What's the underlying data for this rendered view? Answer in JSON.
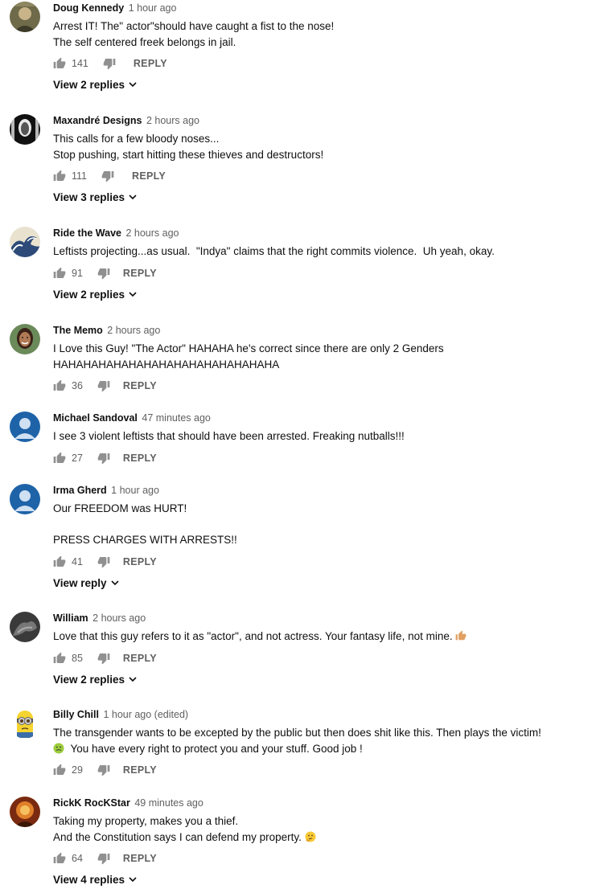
{
  "icons": {
    "like": "thumbs-up-icon",
    "dislike": "thumbs-down-icon",
    "expand": "chevron-down-icon"
  },
  "colors": {
    "text": "#0f0f0f",
    "secondary": "#606060",
    "default_avatar_bg": "#1e63a8"
  },
  "comments": [
    {
      "author": "Doug Kennedy",
      "time": "1 hour ago",
      "lines": [
        "Arrest IT! The\" actor\"should have caught a fist to the nose!",
        "The self centered freek belongs in jail."
      ],
      "likes": "141",
      "reply_label": "REPLY",
      "view_replies": "View 2 replies"
    },
    {
      "author": "Maxandré Designs",
      "time": "2 hours ago",
      "lines": [
        "This calls for a few bloody noses...",
        "Stop pushing, start hitting these thieves and destructors!"
      ],
      "likes": "111",
      "reply_label": "REPLY",
      "view_replies": "View 3 replies"
    },
    {
      "author": "Ride the Wave",
      "time": "2 hours ago",
      "lines": [
        "Leftists projecting...as usual.  \"Indya\" claims that the right commits violence.  Uh yeah, okay."
      ],
      "likes": "91",
      "reply_label": "REPLY",
      "view_replies": "View 2 replies"
    },
    {
      "author": "The Memo",
      "time": "2 hours ago",
      "lines": [
        "I Love this Guy! \"The Actor\" HAHAHA he's correct since there are only 2 Genders",
        "HAHAHAHAHAHAHAHAHAHAHAHAHAHAHA"
      ],
      "likes": "36",
      "reply_label": "REPLY"
    },
    {
      "author": "Michael Sandoval",
      "time": "47 minutes ago",
      "lines": [
        "I see 3 violent leftists that should have been arrested. Freaking nutballs!!!"
      ],
      "likes": "27",
      "reply_label": "REPLY"
    },
    {
      "author": "Irma Gherd",
      "time": "1 hour ago",
      "lines": [
        "Our FREEDOM was HURT!",
        "",
        "PRESS CHARGES WITH ARRESTS!!"
      ],
      "likes": "41",
      "reply_label": "REPLY",
      "view_replies": "View reply"
    },
    {
      "author": "William",
      "time": "2 hours ago",
      "lines": [
        "Love that this guy refers to it as \"actor\", and not actress. Your fantasy life, not mine."
      ],
      "emoji": "thumbs-up-emoji",
      "likes": "85",
      "reply_label": "REPLY",
      "view_replies": "View 2 replies"
    },
    {
      "author": "Billy Chill",
      "time": "1 hour ago (edited)",
      "lines": [
        "The transgender wants to be excepted by the public but then does shit like this. Then plays the victim!",
        "You have every right to protect you and your stuff. Good job !"
      ],
      "lead_emoji": "nauseated-face-emoji",
      "likes": "29",
      "reply_label": "REPLY"
    },
    {
      "author": "RickK RocKStar",
      "time": "49 minutes ago",
      "lines": [
        "Taking my property, makes you a thief.",
        "And the Constitution says I can defend my property."
      ],
      "emoji": "thinking-face-emoji",
      "likes": "64",
      "reply_label": "REPLY",
      "view_replies": "View 4 replies"
    }
  ]
}
